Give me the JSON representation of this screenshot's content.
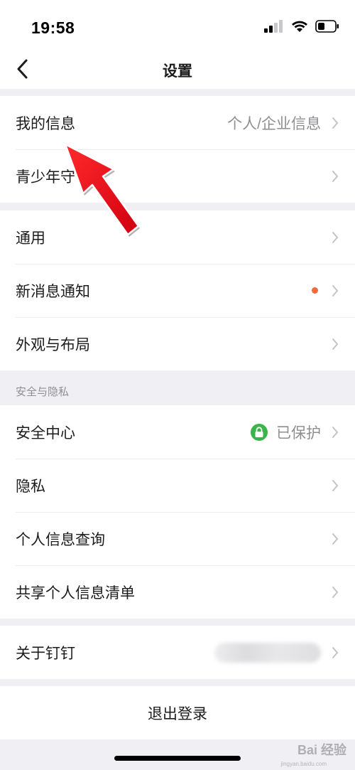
{
  "status_bar": {
    "time": "19:58"
  },
  "nav": {
    "title": "设置"
  },
  "groups": [
    {
      "rows": [
        {
          "label": "我的信息",
          "value": "个人/企业信息"
        },
        {
          "label": "青少年守"
        }
      ]
    },
    {
      "rows": [
        {
          "label": "通用"
        },
        {
          "label": "新消息通知"
        },
        {
          "label": "外观与布局"
        }
      ]
    }
  ],
  "security_section": {
    "header": "安全与隐私",
    "rows": [
      {
        "label": "安全中心",
        "value": "已保护"
      },
      {
        "label": "隐私"
      },
      {
        "label": "个人信息查询"
      },
      {
        "label": "共享个人信息清单"
      }
    ]
  },
  "about": {
    "label": "关于钉钉"
  },
  "logout": {
    "label": "退出登录"
  },
  "watermark": {
    "text": "Bai 经验",
    "sub": "jingyan.baidu.com"
  },
  "colors": {
    "accent_dot": "#ed6b3d",
    "lock_green": "#3ab54a",
    "arrow_red": "#e8101a"
  },
  "icons": [
    "signal-icon",
    "wifi-icon",
    "battery-icon",
    "back-chevron-icon",
    "chevron-right-icon",
    "lock-icon",
    "red-arrow-annotation"
  ]
}
